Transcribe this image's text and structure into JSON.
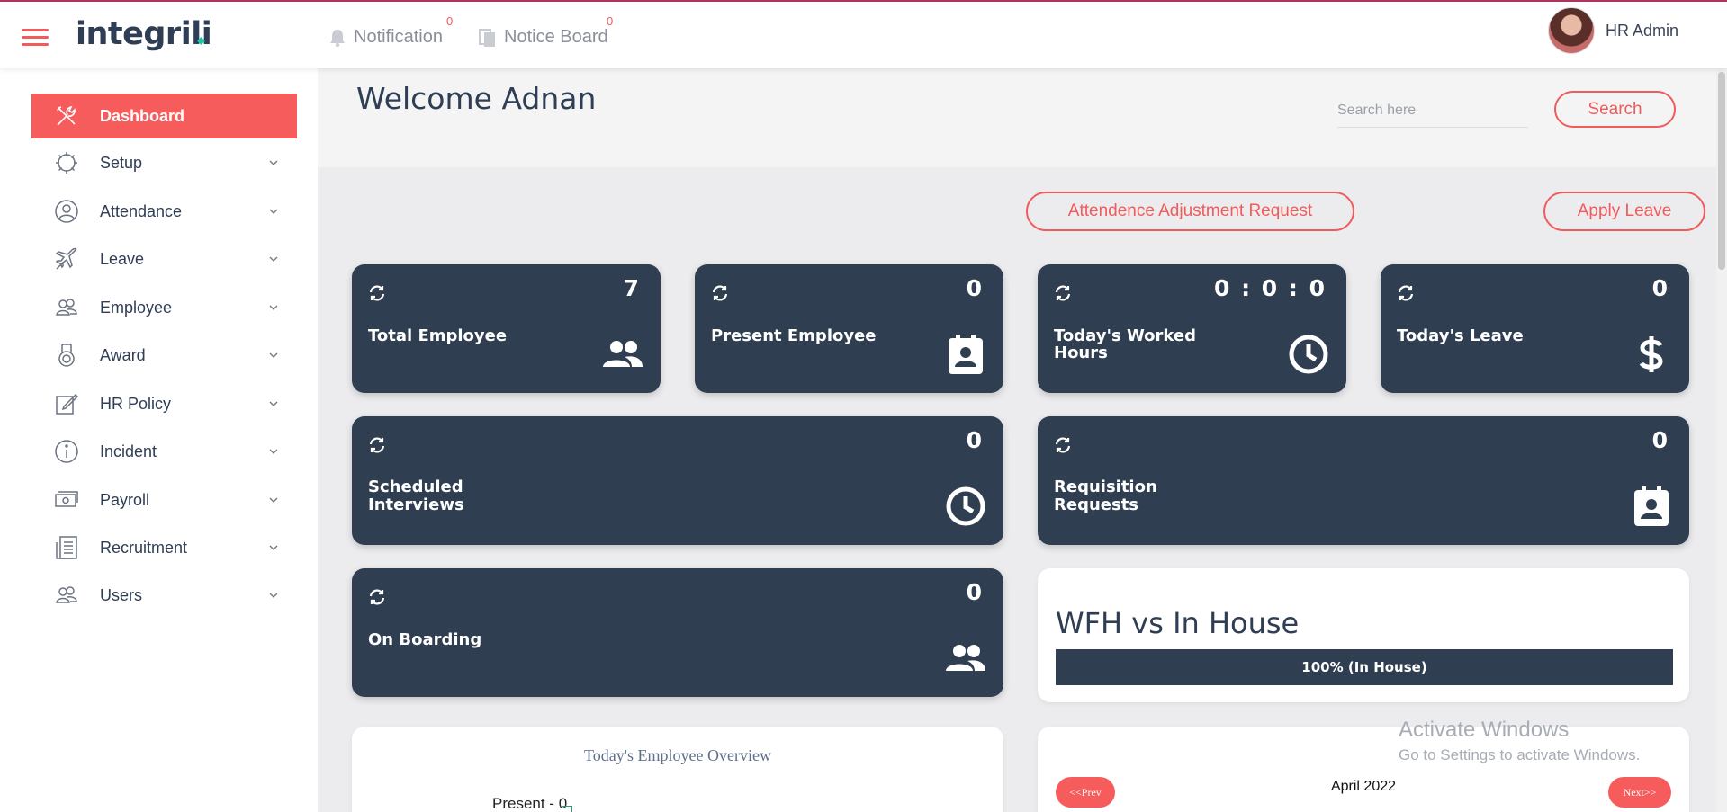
{
  "header": {
    "logo": "integrili",
    "notification_label": "Notification",
    "notification_count": "0",
    "notice_board_label": "Notice Board",
    "notice_board_count": "0",
    "user_name": "HR Admin"
  },
  "sidebar": {
    "items": [
      {
        "label": "Dashboard",
        "icon": "tools-icon",
        "active": true
      },
      {
        "label": "Setup",
        "icon": "gear-icon"
      },
      {
        "label": "Attendance",
        "icon": "user-circle-icon"
      },
      {
        "label": "Leave",
        "icon": "airplane-icon"
      },
      {
        "label": "Employee",
        "icon": "people-icon"
      },
      {
        "label": "Award",
        "icon": "medal-icon"
      },
      {
        "label": "HR Policy",
        "icon": "edit-icon"
      },
      {
        "label": "Incident",
        "icon": "info-icon"
      },
      {
        "label": "Payroll",
        "icon": "cash-icon"
      },
      {
        "label": "Recruitment",
        "icon": "document-icon"
      },
      {
        "label": "Users",
        "icon": "users-icon"
      }
    ]
  },
  "main": {
    "welcome": "Welcome Adnan",
    "search_placeholder": "Search here",
    "search_button": "Search",
    "attendance_adjustment_button": "Attendence Adjustment Request",
    "apply_leave_button": "Apply Leave"
  },
  "cards": {
    "total_employee": {
      "title": "Total Employee",
      "value": "7"
    },
    "present_employee": {
      "title": "Present Employee",
      "value": "0"
    },
    "worked_hours": {
      "title_1": "Today's Worked",
      "title_2": "Hours",
      "value": "0 : 0 : 0"
    },
    "todays_leave": {
      "title": "Today's Leave",
      "value": "0"
    },
    "scheduled_interviews": {
      "title_1": "Scheduled",
      "title_2": "Interviews",
      "value": "0"
    },
    "requisition_requests": {
      "title_1": "Requisition",
      "title_2": "Requests",
      "value": "0"
    },
    "on_boarding": {
      "title": "On Boarding",
      "value": "0"
    }
  },
  "wfh": {
    "title": "WFH vs In House",
    "bar_label": "100% (In House)",
    "in_house_percent": 100
  },
  "overview": {
    "title": "Today's Employee Overview",
    "present_label": "Present - 0"
  },
  "calendar": {
    "prev_label": "<<Prev",
    "month": "April 2022",
    "next_label": "Next>>"
  },
  "watermark": {
    "line1": "Activate Windows",
    "line2": "Go to Settings to activate Windows."
  },
  "colors": {
    "accent": "#f75c5c",
    "card_bg": "#2f3e50",
    "text_primary": "#2f3d55"
  }
}
